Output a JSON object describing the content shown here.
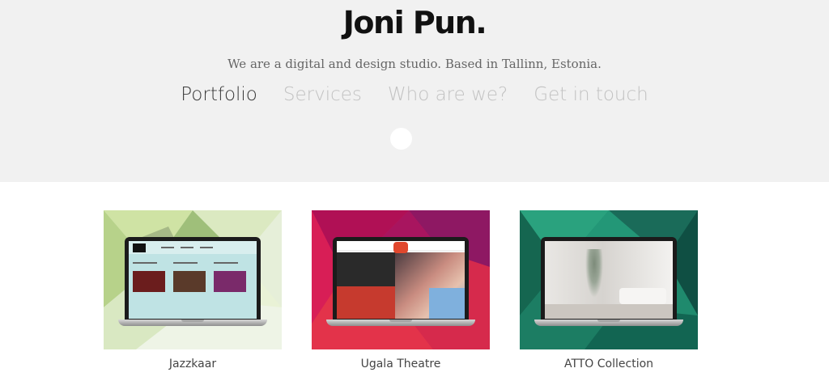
{
  "header": {
    "logo": "Joni Pun.",
    "tagline": "We are a digital and design studio. Based in Tallinn, Estonia."
  },
  "nav": {
    "items": [
      {
        "label": "Portfolio",
        "active": true
      },
      {
        "label": "Services",
        "active": false
      },
      {
        "label": "Who are we?",
        "active": false
      },
      {
        "label": "Get in touch",
        "active": false
      }
    ]
  },
  "portfolio": {
    "items": [
      {
        "title": "Jazzkaar"
      },
      {
        "title": "Ugala Theatre"
      },
      {
        "title": "ATTO Collection"
      }
    ]
  },
  "colors": {
    "hero_bg": "#f1f1f1",
    "nav_active": "#3a3a3a",
    "nav_inactive": "#c2c2c2"
  }
}
